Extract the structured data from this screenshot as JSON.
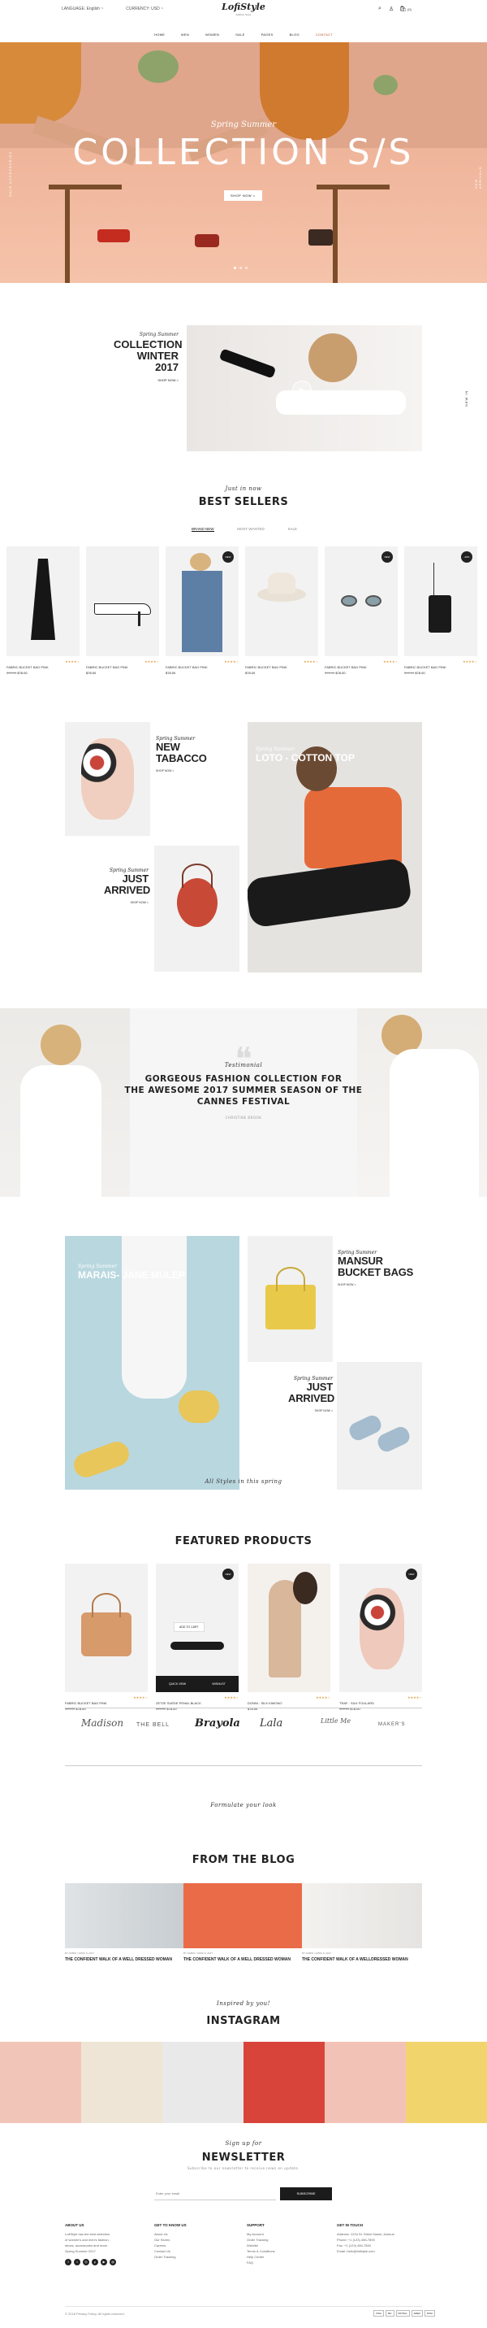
{
  "topbar": {
    "language_label": "LANGUAGE: English ~",
    "currency_label": "CURRENCY: USD ~",
    "logo": "LofiStyle",
    "logo_sub": "Fashion Store",
    "cart_count": "(0)"
  },
  "nav": [
    "HOME",
    "MEN",
    "WOMEN",
    "SALE",
    "PAGES",
    "BLOG",
    "CONTACT"
  ],
  "hero": {
    "script": "Spring Summer",
    "title": "COLLECTION S/S",
    "button": "SHOP NOW >",
    "left_vertical": "SALE ACCESSORIES",
    "right_vertical": "NEW ARRIVALS"
  },
  "video_promo": {
    "script": "Spring Summer",
    "title_lines": [
      "COLLECTION",
      "WINTER",
      "2017"
    ],
    "link": "SHOP NOW >",
    "side_label": "NEW IN"
  },
  "best_sellers": {
    "script": "Just in now",
    "title": "BEST SELLERS",
    "tabs": [
      "BRAND NEW",
      "MOST WANTED",
      "SALE"
    ],
    "products": [
      {
        "name": "FABRIC BUCKET BAG PINK",
        "price": "$78.00",
        "old": "$95.00",
        "badge": ""
      },
      {
        "name": "FABRIC BUCKET BAG PINK",
        "price": "$78.00",
        "old": "",
        "badge": ""
      },
      {
        "name": "FABRIC BUCKET BAG PINK",
        "price": "$78.00",
        "old": "",
        "badge": "NEW"
      },
      {
        "name": "FABRIC BUCKET BAG PINK",
        "price": "$78.00",
        "old": "",
        "badge": ""
      },
      {
        "name": "FABRIC BUCKET BAG PINK",
        "price": "$78.00",
        "old": "$95.00",
        "badge": "NEW"
      },
      {
        "name": "FABRIC BUCKET BAG PINK",
        "price": "$78.00",
        "old": "$95.00",
        "badge": "-20%"
      }
    ]
  },
  "promo_grid1": {
    "card1": {
      "script": "Spring Summer",
      "title_lines": [
        "NEW",
        "TABACCO"
      ],
      "link": "SHOP NOW >"
    },
    "card2": {
      "script": "Spring Summer",
      "title_lines": [
        "JUST",
        "ARRIVED"
      ],
      "link": "SHOP NOW >"
    },
    "card3": {
      "script": "Spring Summer",
      "title": "LOTO - COTTON TOP"
    }
  },
  "testimonial": {
    "script": "Testimonial",
    "quote_lines": [
      "GORGEOUS FASHION COLLECTION FOR",
      "THE AWESOME 2017 SUMMER SEASON OF THE",
      "CANNES FESTIVAL"
    ],
    "author": "CHRISTINE BROOK"
  },
  "promo_grid2": {
    "card1": {
      "script": "Spring Summer",
      "title": "MARAIS- JANE MULEP"
    },
    "card2": {
      "script": "Spring Summer",
      "title_lines": [
        "MANSUR",
        "BUCKET BAGS"
      ],
      "link": "SHOP NOW >"
    },
    "card3": {
      "script": "Spring Summer",
      "title_lines": [
        "JUST",
        "ARRIVED"
      ],
      "link": "SHOP NOW >"
    }
  },
  "featured": {
    "script": "All Styles in this spring",
    "title": "FEATURED PRODUCTS",
    "add_to_cart": "ADD TO CART",
    "quick_view": "QUICK VIEW",
    "wishlist": "WISHLIST",
    "products": [
      {
        "name": "FABRIC BUCKET BAG PINK",
        "price": "$78.00",
        "old": "$95.00",
        "badge": ""
      },
      {
        "name": "ZETZE SUEDE PENAL BLACK",
        "price": "$78.00",
        "old": "$95.00",
        "badge": "NEW"
      },
      {
        "name": "DONNI - SILK KIMONO",
        "price": "$78.00",
        "old": "",
        "badge": ""
      },
      {
        "name": "TRAF - SILK FOULARD",
        "price": "$78.00",
        "old": "$95.00",
        "badge": "NEW"
      }
    ]
  },
  "brands": [
    "Madison",
    "THE BELL",
    "Brayola",
    "Lala",
    "Little Me",
    "MAKER'S"
  ],
  "blog": {
    "script": "Formulate your look",
    "title": "FROM THE BLOG",
    "posts": [
      {
        "meta": "BY ADMIN / APRIL 8, 2017",
        "title": "THE CONFIDENT WALK OF A WELL DRESSED WOMAN"
      },
      {
        "meta": "BY ADMIN / APRIL 8, 2017",
        "title": "THE CONFIDENT WALK OF A WELL DRESSED WOMAN"
      },
      {
        "meta": "BY ADMIN / APRIL 8, 2017",
        "title": "THE CONFIDENT WALK OF A WELLDRESSED WOMAN"
      }
    ]
  },
  "instagram": {
    "script": "Inspired by you!",
    "title": "INSTAGRAM"
  },
  "newsletter": {
    "script": "Sign up for",
    "title": "NEWSLETTER",
    "subtitle": "Subscribe to our newsletter to receive news on update.",
    "placeholder": "Enter your email",
    "button": "SUBSCRIBE"
  },
  "footer": {
    "about": {
      "title": "ABOUT US",
      "text": [
        "LofiStyle has the best selection",
        "of women's and men's fashion,",
        "shoes, accessories and more.",
        "Spring Summer 2017"
      ]
    },
    "get_to_know": {
      "title": "GET TO KNOW US",
      "links": [
        "About Us",
        "Our Stores",
        "Careers",
        "Contact Us",
        "Order Tracking"
      ]
    },
    "support": {
      "title": "SUPPORT",
      "links": [
        "My Account",
        "Order Tracking",
        "Wishlist",
        "Terms & Conditions",
        "Help Center",
        "FAQ"
      ]
    },
    "contact": {
      "title": "GET IN TOUCH",
      "text": [
        "Address: 1234 St. Street Name, Avenue",
        "Phone: +1 (123) 456-7890",
        "Fax: +1 (123) 456-7890",
        "Email: hello@lofistyle.com"
      ]
    },
    "copyright": "© 2018 Privacy Policy. All rights reserved.",
    "payments": [
      "VISA",
      "MC",
      "PAYPAL",
      "AMEX",
      "DISC"
    ]
  },
  "colors": {
    "accent": "#b4532a",
    "dark": "#1b1b1b",
    "hero": "#eeb399"
  }
}
